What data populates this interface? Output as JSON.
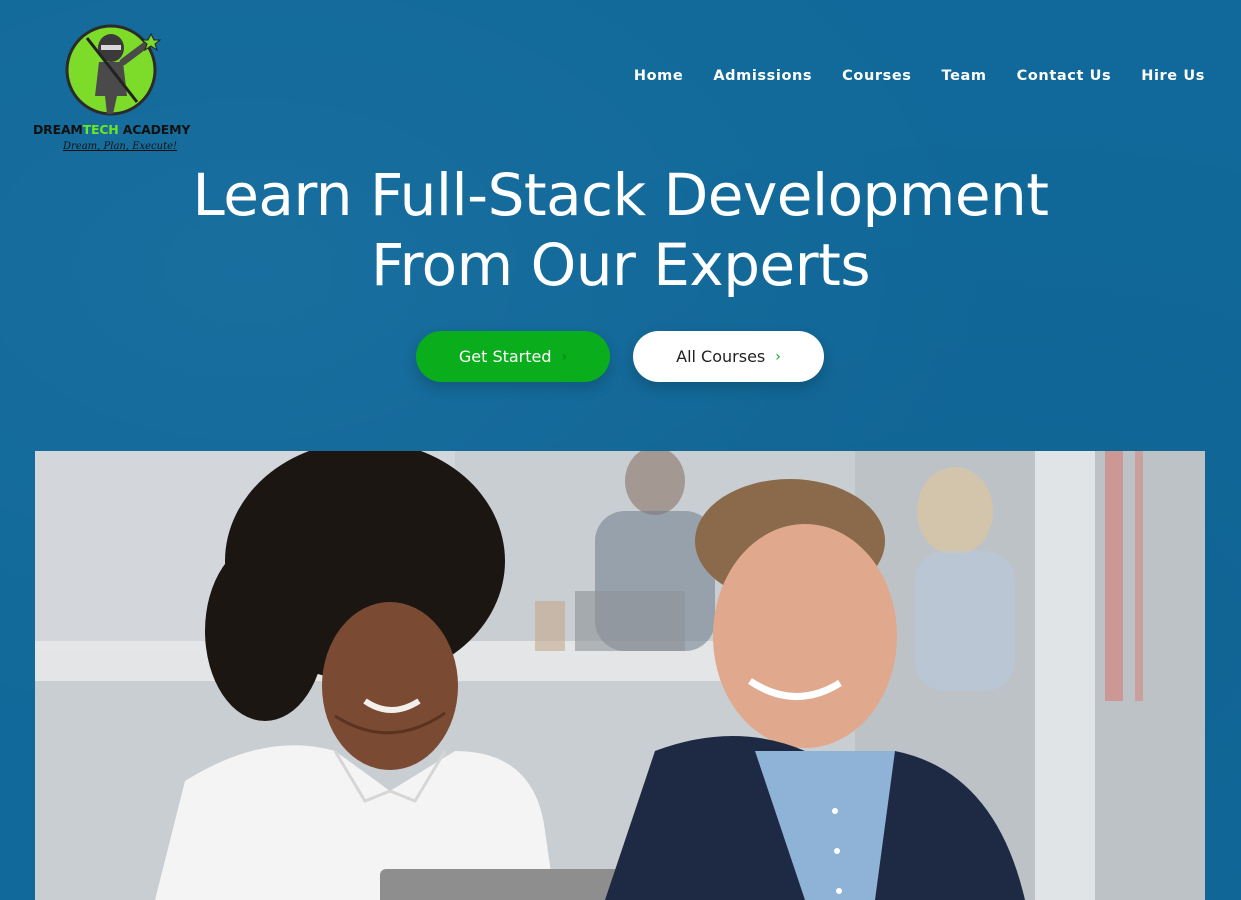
{
  "brand": {
    "name_part1": "DREAM",
    "name_part2": "TECH",
    "name_part3": " ACADEMY",
    "tagline": "Dream, Plan, Execute!",
    "colors": {
      "accent": "#6ee61e",
      "logo_circle": "#7ddc2a"
    }
  },
  "nav": {
    "items": [
      {
        "label": "Home"
      },
      {
        "label": "Admissions"
      },
      {
        "label": "Courses"
      },
      {
        "label": "Team"
      },
      {
        "label": "Contact Us"
      },
      {
        "label": "Hire Us"
      }
    ]
  },
  "hero": {
    "title_line1": "Learn Full-Stack Development",
    "title_line2": "From Our Experts",
    "primary_button": {
      "label": "Get Started",
      "icon": "chevron-right-icon"
    },
    "secondary_button": {
      "label": "All Courses",
      "icon": "chevron-right-icon"
    }
  },
  "colors": {
    "background": "#10699a",
    "primary": "#0aae1c",
    "text": "#ffffff"
  }
}
